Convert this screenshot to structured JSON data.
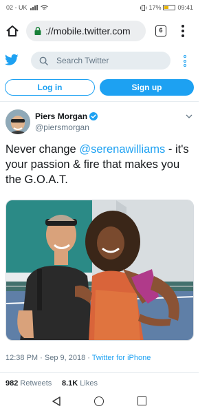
{
  "status_bar": {
    "carrier": "02 - UK",
    "battery_percent": "17%",
    "time": "09:41",
    "battery_level": 0.17
  },
  "browser": {
    "url": "://mobile.twitter.com",
    "tab_count": "6",
    "icons": [
      "home-icon",
      "lock-icon",
      "menu-dots-icon"
    ]
  },
  "twitter": {
    "search_placeholder": "Search Twitter",
    "login_label": "Log in",
    "signup_label": "Sign up",
    "accent": "#1da1f2"
  },
  "tweet": {
    "author_name": "Piers Morgan",
    "author_handle": "@piersmorgan",
    "text_prefix": "Never change ",
    "mention": "@serenawilliams",
    "text_suffix": " - it's your passion & fire that makes you the G.O.A.T.",
    "timestamp": "12:38 PM · Sep 9, 2018 · ",
    "source": "Twitter for iPhone",
    "retweets_count": "982",
    "retweets_label": " Retweets",
    "likes_count": "8.1K",
    "likes_label": " Likes"
  }
}
